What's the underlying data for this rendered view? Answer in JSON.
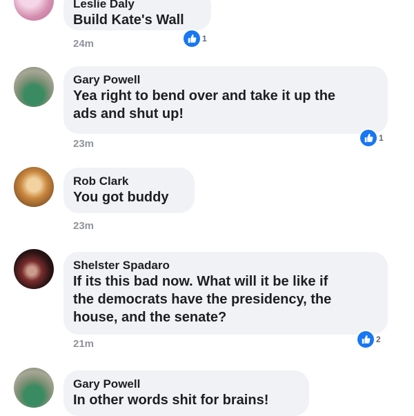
{
  "comments": [
    {
      "author": "Leslie Daly",
      "lines": [
        "Build Kate's Wall"
      ],
      "time": "24m",
      "reactions": "1"
    },
    {
      "author": "Gary Powell",
      "lines": [
        "Yea right to bend over and take it up the",
        "ads and shut up!"
      ],
      "time": "23m",
      "reactions": "1"
    },
    {
      "author": "Rob Clark",
      "lines": [
        "You got buddy"
      ],
      "time": "23m",
      "reactions": ""
    },
    {
      "author": "Shelster Spadaro",
      "lines": [
        "If its this bad now. What will it be like if",
        "the democrats have the presidency, the",
        "house, and the senate?"
      ],
      "time": "21m",
      "reactions": "2"
    },
    {
      "author": "Gary Powell",
      "lines": [
        "In other words shit for brains!"
      ],
      "time": "",
      "reactions": ""
    }
  ],
  "icons": {
    "reaction": "thumbs-up-icon",
    "reaction_color": "#1877f2",
    "bubble_color": "#f0f2f5"
  }
}
